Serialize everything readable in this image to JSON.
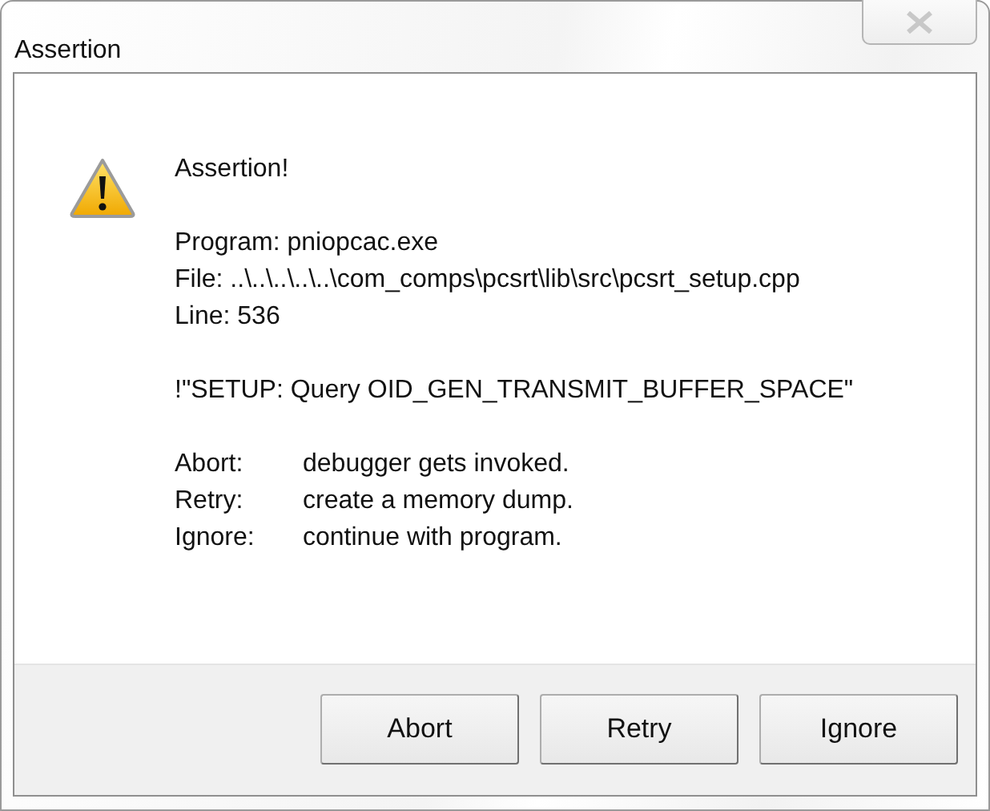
{
  "window": {
    "title": "Assertion"
  },
  "message": {
    "heading": "Assertion!",
    "details": [
      "Program: pniopcac.exe",
      "File: ..\\..\\..\\..\\..\\com_comps\\pcsrt\\lib\\src\\pcsrt_setup.cpp",
      "Line: 536"
    ],
    "expression": "!\"SETUP: Query OID_GEN_TRANSMIT_BUFFER_SPACE\"",
    "options": [
      {
        "label": "Abort:",
        "description": "debugger gets invoked."
      },
      {
        "label": "Retry:",
        "description": "create a memory dump."
      },
      {
        "label": "Ignore:",
        "description": "continue with program."
      }
    ]
  },
  "buttons": [
    "Abort",
    "Retry",
    "Ignore"
  ]
}
